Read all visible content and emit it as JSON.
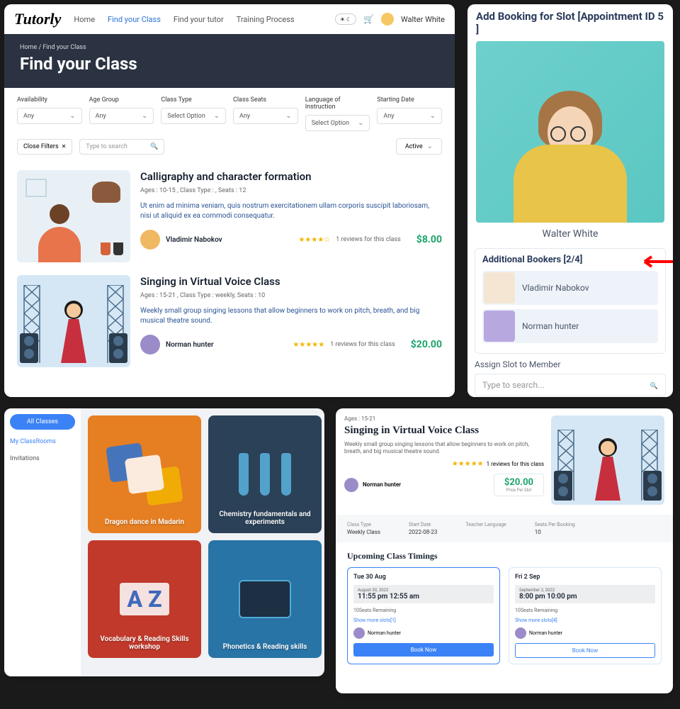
{
  "topnav": {
    "logo": "Tutorly",
    "links": [
      "Home",
      "Find your Class",
      "Find your tutor",
      "Training Process"
    ],
    "user": "Walter White"
  },
  "hero": {
    "breadcrumb": "Home / Find your Class",
    "title": "Find your Class"
  },
  "filters": [
    {
      "label": "Availability",
      "value": "Any"
    },
    {
      "label": "Age Group",
      "value": "Any"
    },
    {
      "label": "Class Type",
      "value": "Select Option"
    },
    {
      "label": "Class Seats",
      "value": "Any"
    },
    {
      "label": "Language of Instruction",
      "value": "Select Option"
    },
    {
      "label": "Starting Date",
      "value": "Any"
    }
  ],
  "closeFilters": "Close Filters",
  "searchPlaceholder": "Type to search",
  "status": "Active",
  "classes": [
    {
      "title": "Calligraphy and character formation",
      "meta": "Ages : 10-15 , Class Type : , Seats : 12",
      "desc": "Ut enim ad minima veniam, quis nostrum exercitationem ullam corporis suscipit laboriosam, nisi ut aliquid ex ea commodi consequatur.",
      "tutor": "Vladimir Nabokov",
      "stars": "★★★★☆",
      "reviews": "1 reviews for this class",
      "price": "$8.00"
    },
    {
      "title": "Singing in Virtual Voice Class",
      "meta": "Ages : 15-21 , Class Type : weekly, Seats : 10",
      "desc": "Weekly small group singing lessons that allow beginners to work on pitch, breath, and big musical theatre sound.",
      "tutor": "Norman hunter",
      "stars": "★★★★★",
      "reviews": "1 reviews for this class",
      "price": "$20.00"
    }
  ],
  "p2": {
    "title": "Add Booking for Slot [Appointment ID 5 ]",
    "name": "Walter White",
    "sectionTitle": "Additional Bookers [2/4]",
    "bookers": [
      "Vladimir Nabokov",
      "Norman hunter"
    ],
    "assignLabel": "Assign Slot to Member",
    "searchPlaceholder": "Type to search..."
  },
  "p3": {
    "allClasses": "All Classes",
    "myClassrooms": "My ClassRooms",
    "invitations": "Invitations",
    "cards": [
      "Dragon dance in Madarin",
      "Chemistry fundamentals and experiments",
      "Vocabulary &amp; Reading Skills workshop",
      "Phonetics &amp; Reading skills"
    ]
  },
  "p4": {
    "ages": "Ages : 15-21",
    "title": "Singing in Virtual Voice Class",
    "desc": "Weekly small group singing lessons that allow beginners to work on pitch, breath, and big musical theatre sound.",
    "stars": "★★★★★",
    "reviews": "1 reviews for this class",
    "tutor": "Norman hunter",
    "price": "$20.00",
    "priceLabel": "Price Per Slot",
    "meta": [
      {
        "label": "Class Type",
        "value": "Weekly Class"
      },
      {
        "label": "Start Date",
        "value": "2022-08-23"
      },
      {
        "label": "Teacher Language",
        "value": ""
      },
      {
        "label": "Seats Per Booking",
        "value": "10"
      }
    ],
    "upcomingTitle": "Upcoming Class Timings",
    "slots": [
      {
        "day": "Tue 30 Aug",
        "date": "August 30, 2022",
        "time": "11:55 pm   12:55 am",
        "remain": "10Seats Remaining",
        "more": "Show more slots[1]",
        "tutor": "Norman hunter",
        "book": "Book Now"
      },
      {
        "day": "Fri 2 Sep",
        "date": "September 2, 2022",
        "time": "8:00 pm   10:00 pm",
        "remain": "10Seats Remaining",
        "more": "Show more slots[4]",
        "tutor": "Norman hunter",
        "book": "Book Now"
      }
    ]
  }
}
